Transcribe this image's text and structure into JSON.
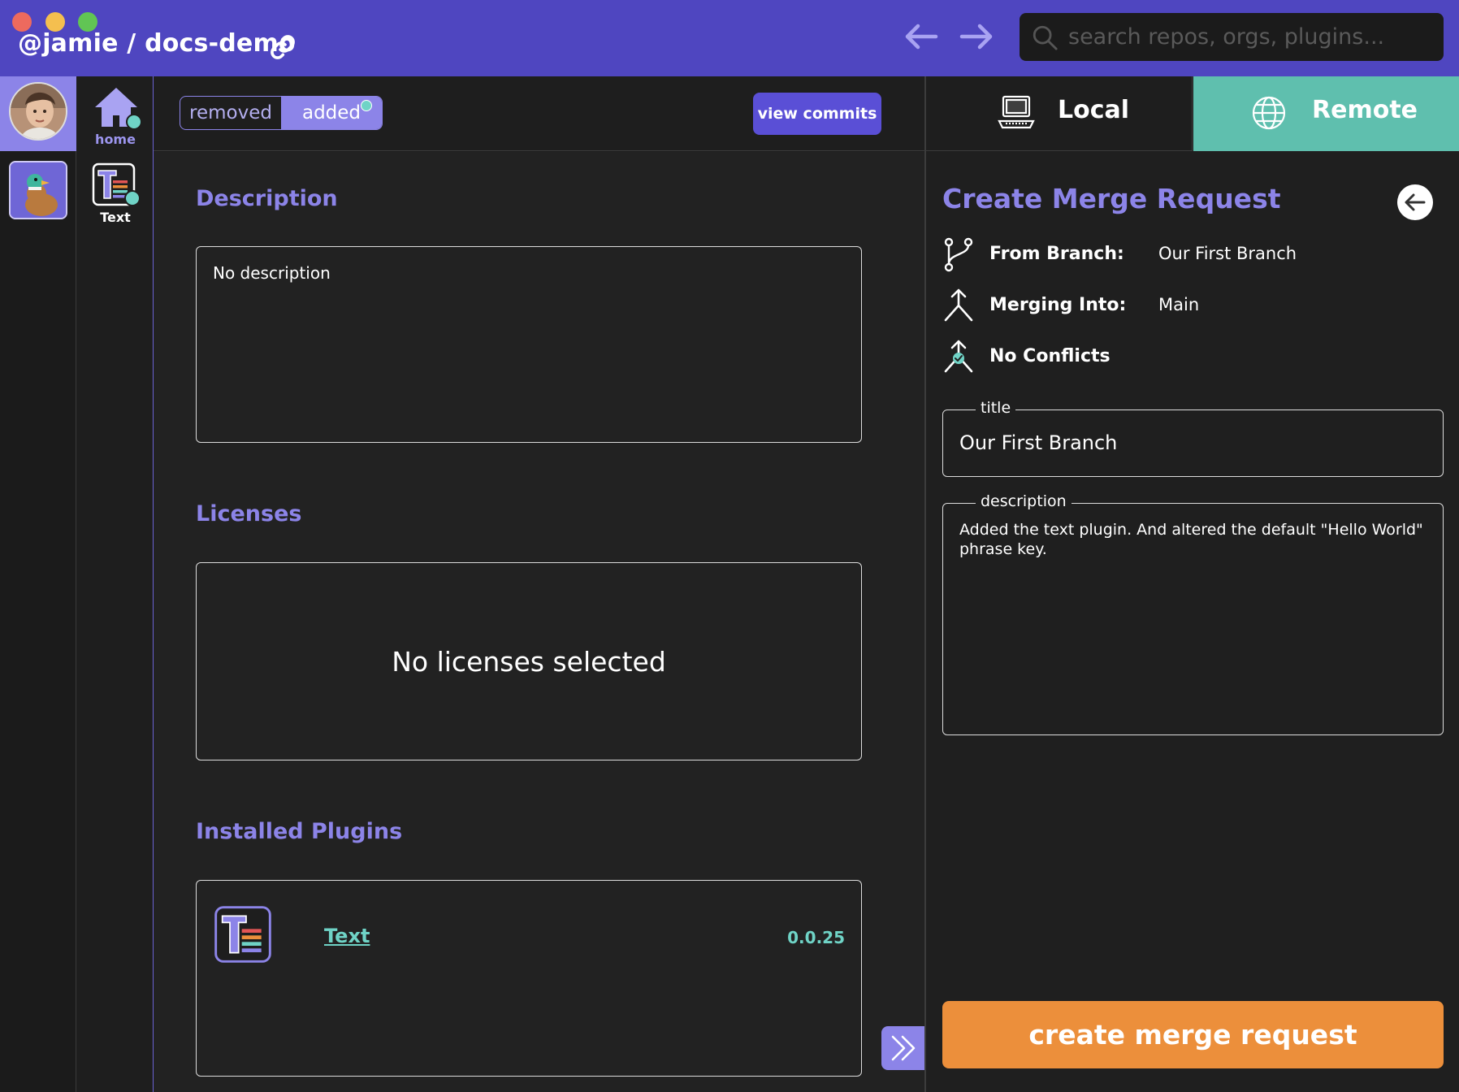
{
  "titlebar": {
    "repo_title": "@jamie / docs-demo",
    "search_placeholder": "search repos, orgs, plugins..."
  },
  "sidebar": {
    "home_label": "home",
    "plugin_label": "Text"
  },
  "toolbar": {
    "toggle_removed": "removed",
    "toggle_added": "added",
    "toggle_selected": "added",
    "view_commits": "view commits"
  },
  "main": {
    "description": {
      "title": "Description",
      "text": "No description"
    },
    "licenses": {
      "title": "Licenses",
      "empty_text": "No licenses selected"
    },
    "plugins": {
      "title": "Installed Plugins",
      "items": [
        {
          "name": "Text",
          "version": "0.0.25"
        }
      ]
    }
  },
  "tabs": {
    "local": "Local",
    "remote": "Remote",
    "active": "Remote"
  },
  "merge_request": {
    "title": "Create Merge Request",
    "from_label": "From Branch:",
    "from_value": "Our First Branch",
    "into_label": "Merging Into:",
    "into_value": "Main",
    "conflicts": "No Conflicts",
    "title_legend": "title",
    "title_value": "Our First Branch",
    "description_legend": "description",
    "description_value": "Added the text plugin. And altered the default \"Hello World\" phrase key.",
    "submit": "create merge request"
  },
  "colors": {
    "brand": "#4f46c0",
    "accent": "#8c84e8",
    "teal": "#6fd3c6",
    "remote_tab": "#5fbfae",
    "cta": "#ec8f3b"
  },
  "icons": [
    "link-icon",
    "back-arrow-icon",
    "forward-arrow-icon",
    "search-icon",
    "home-icon",
    "text-plugin-icon",
    "laptop-icon",
    "globe-icon",
    "back-circle-icon",
    "branch-icon",
    "merge-icon",
    "no-conflicts-icon",
    "double-chevron-right-icon"
  ]
}
